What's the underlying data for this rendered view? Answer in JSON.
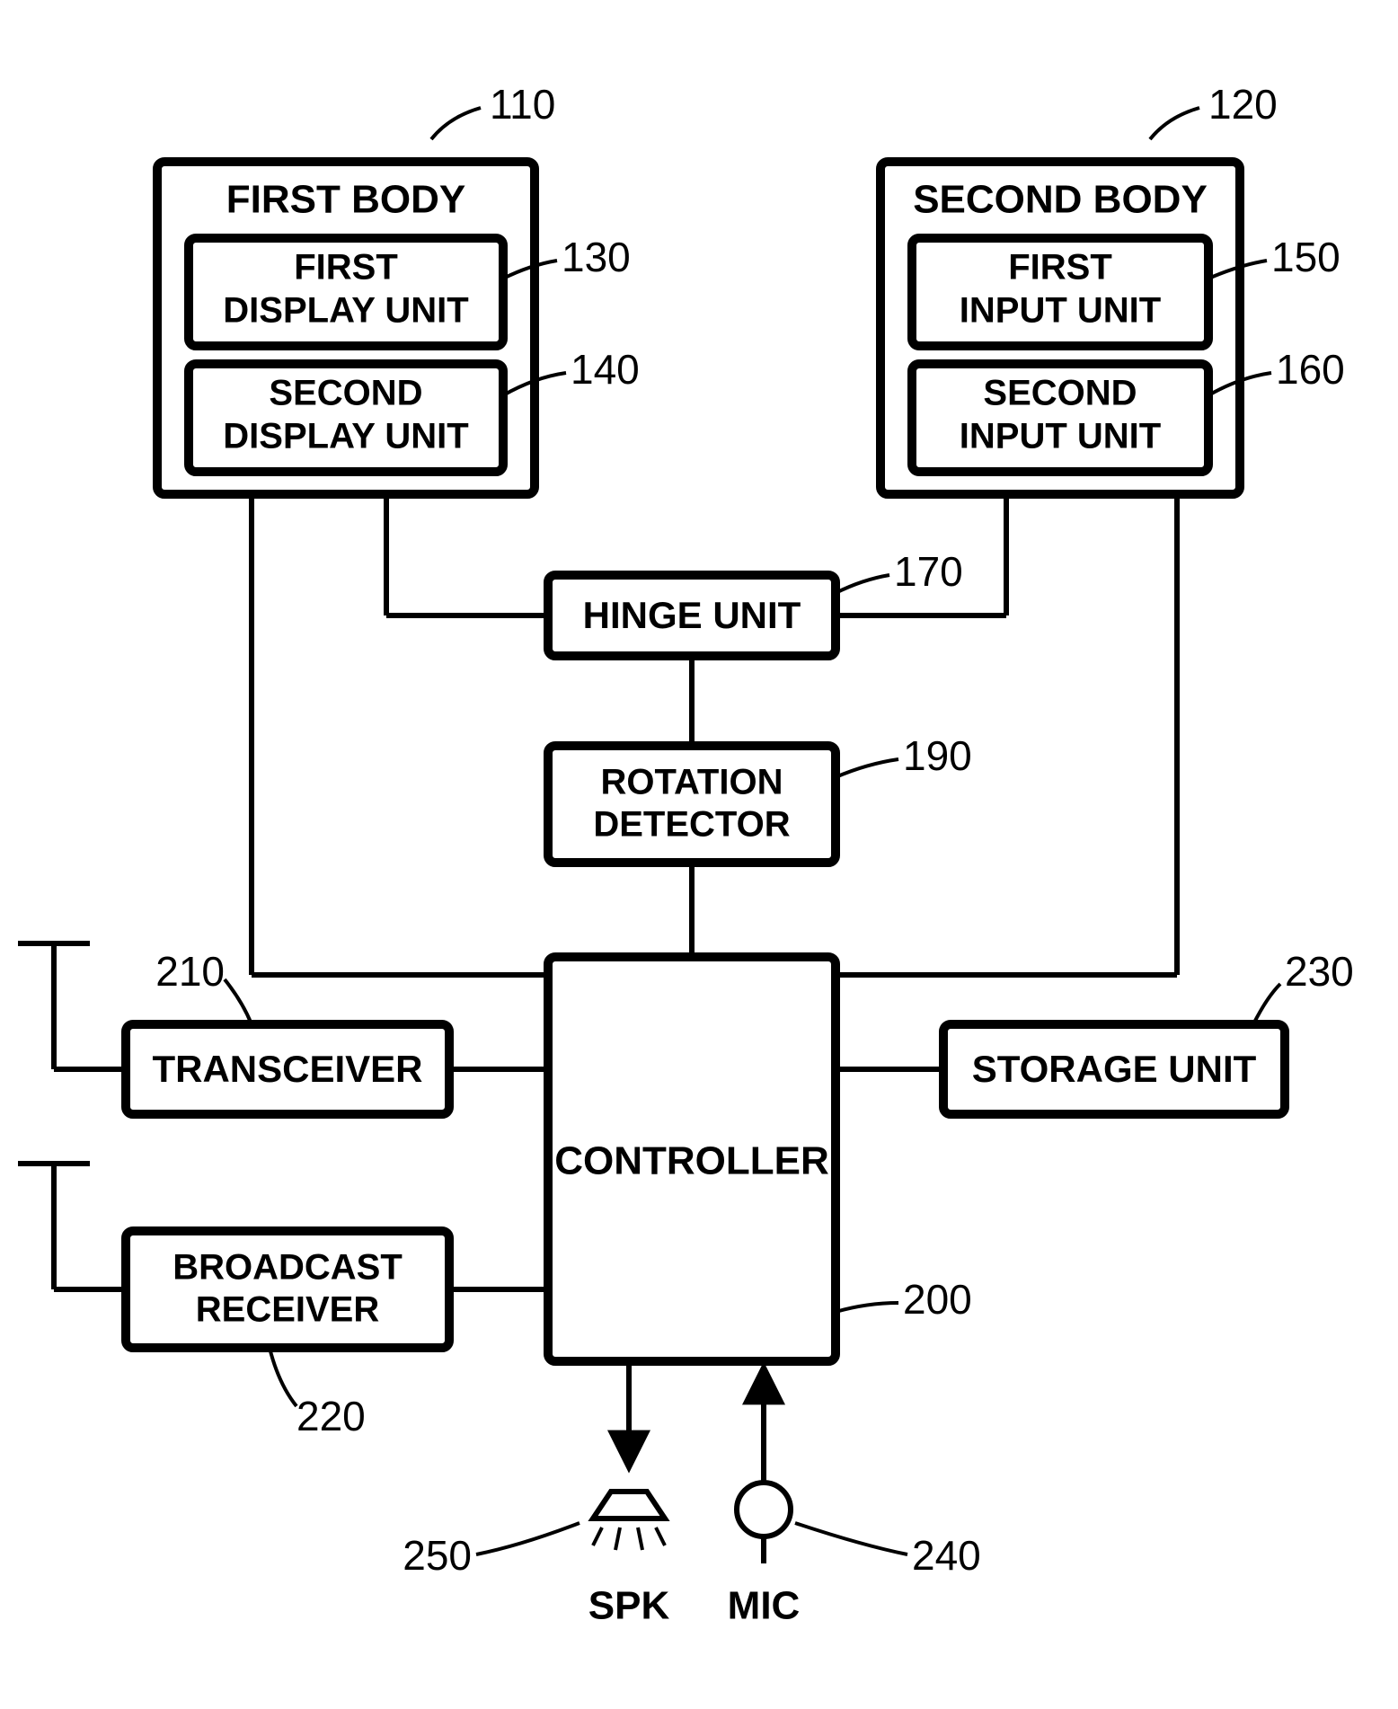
{
  "blocks": {
    "first_body": {
      "title": "FIRST BODY",
      "ref": "110"
    },
    "first_display": {
      "title": "FIRST\nDISPLAY UNIT",
      "ref": "130"
    },
    "second_display": {
      "title": "SECOND\nDISPLAY UNIT",
      "ref": "140"
    },
    "second_body": {
      "title": "SECOND BODY",
      "ref": "120"
    },
    "first_input": {
      "title": "FIRST\nINPUT UNIT",
      "ref": "150"
    },
    "second_input": {
      "title": "SECOND\nINPUT UNIT",
      "ref": "160"
    },
    "hinge": {
      "title": "HINGE UNIT",
      "ref": "170"
    },
    "rotation": {
      "title": "ROTATION\nDETECTOR",
      "ref": "190"
    },
    "controller": {
      "title": "CONTROLLER",
      "ref": "200"
    },
    "transceiver": {
      "title": "TRANSCEIVER",
      "ref": "210"
    },
    "broadcast": {
      "title": "BROADCAST\nRECEIVER",
      "ref": "220"
    },
    "storage": {
      "title": "STORAGE UNIT",
      "ref": "230"
    },
    "spk": {
      "title": "SPK",
      "ref": "250"
    },
    "mic": {
      "title": "MIC",
      "ref": "240"
    }
  }
}
